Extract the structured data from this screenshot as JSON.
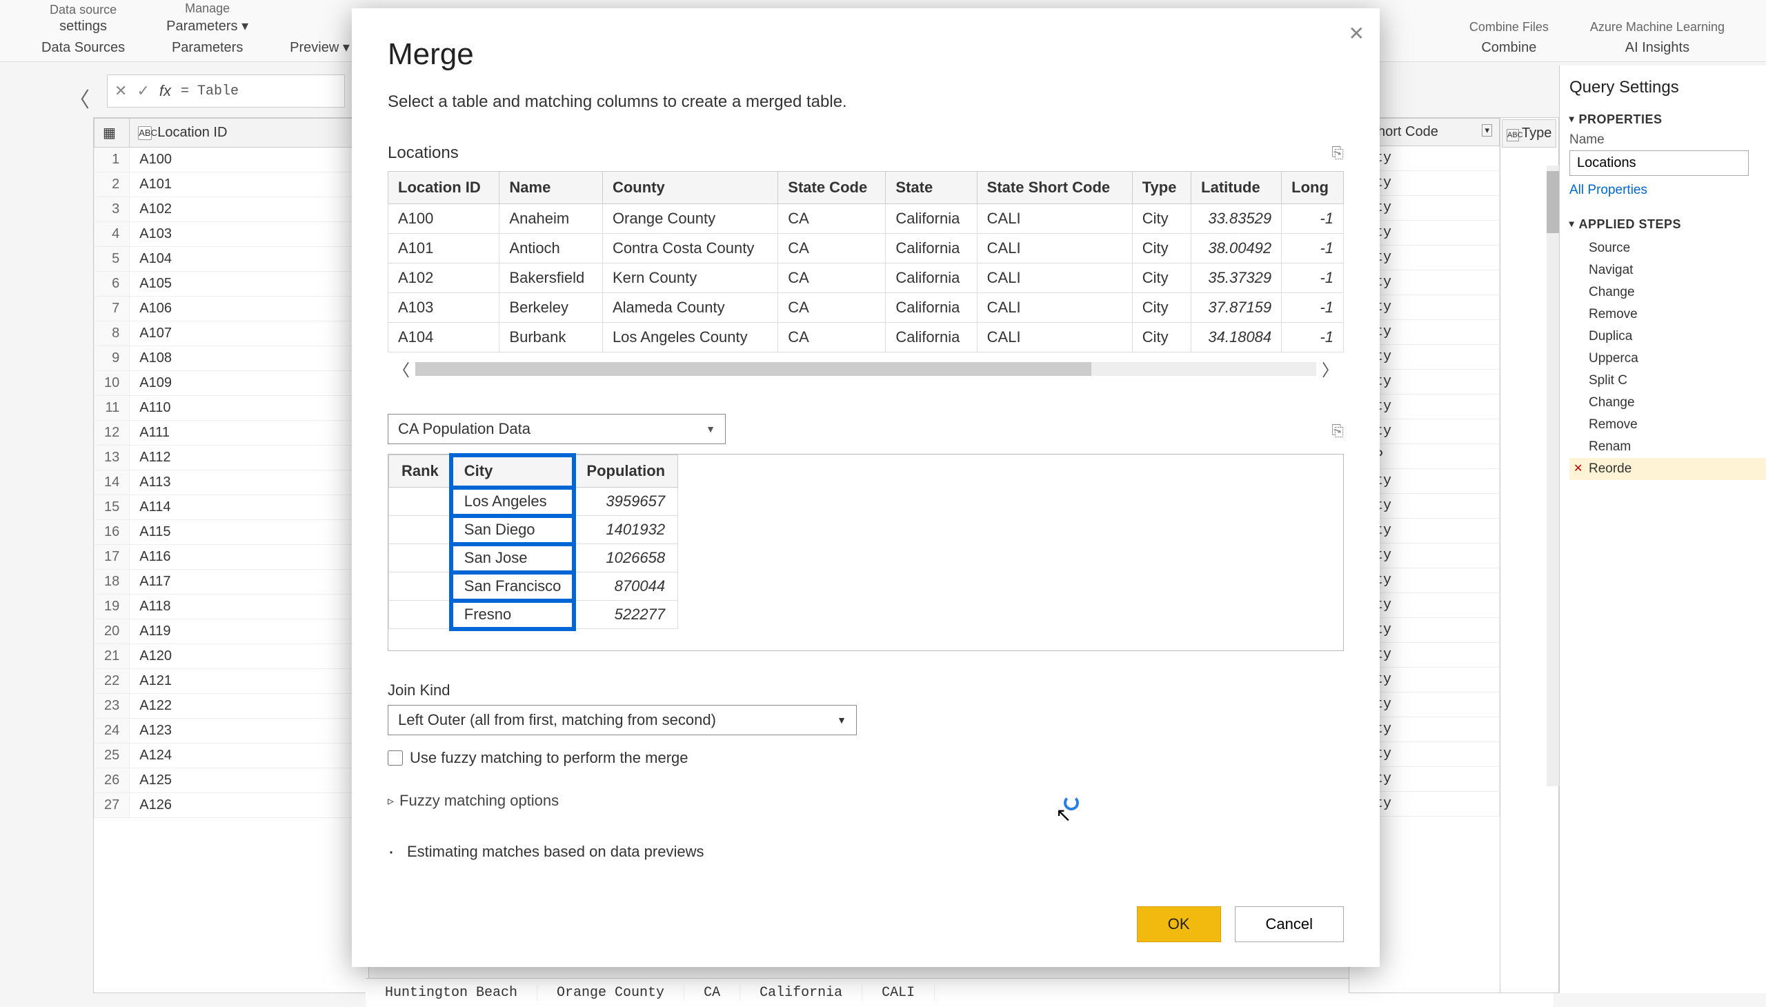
{
  "ribbon": {
    "left1_top": "Data source",
    "left1_bot": "settings",
    "left2_top": "Manage",
    "left2_bot": "Parameters ▾",
    "preview": "Preview ▾",
    "ds": "Data Sources",
    "params": "Parameters",
    "combine": "Combine Files",
    "combine_grp": "Combine",
    "aml": "Azure Machine Learning",
    "ai": "AI Insights"
  },
  "fx": {
    "cancel": "✕",
    "ok": "✓",
    "label": "fx",
    "formula": "= Table"
  },
  "left_table": {
    "col_icon": "ABC",
    "col": "Location ID",
    "rows": [
      "A100",
      "A101",
      "A102",
      "A103",
      "A104",
      "A105",
      "A106",
      "A107",
      "A108",
      "A109",
      "A110",
      "A111",
      "A112",
      "A113",
      "A114",
      "A115",
      "A116",
      "A117",
      "A118",
      "A119",
      "A120",
      "A121",
      "A122",
      "A123",
      "A124",
      "A125",
      "A126"
    ]
  },
  "type_col": {
    "header_short": "e Short Code",
    "header_type_icon": "ABC",
    "header_type": "Type",
    "cells": [
      "City",
      "City",
      "City",
      "City",
      "City",
      "City",
      "City",
      "City",
      "City",
      "City",
      "City",
      "City",
      "CDP",
      "City",
      "City",
      "City",
      "City",
      "City",
      "City",
      "City",
      "City",
      "City",
      "City",
      "City",
      "City",
      "City",
      "City"
    ]
  },
  "bg_row": {
    "name": "Huntington Beach",
    "county": "Orange County",
    "sc": "CA",
    "state": "California",
    "short": "CALI"
  },
  "qs": {
    "title": "Query Settings",
    "prop": "PROPERTIES",
    "name_lbl": "Name",
    "name_val": "Locations",
    "all_props": "All Properties",
    "steps_h": "APPLIED STEPS",
    "steps": [
      "Source",
      "Navigat",
      "Change",
      "Remove",
      "Duplica",
      "Upperca",
      "Split C",
      "Change",
      "Remove",
      "Renam",
      "Reorde"
    ]
  },
  "dlg": {
    "title": "Merge",
    "desc": "Select a table and matching columns to create a merged table.",
    "t1_label": "Locations",
    "t1_headers": [
      "Location ID",
      "Name",
      "County",
      "State Code",
      "State",
      "State Short Code",
      "Type",
      "Latitude",
      "Long"
    ],
    "t1_rows": [
      [
        "A100",
        "Anaheim",
        "Orange County",
        "CA",
        "California",
        "CALI",
        "City",
        "33.83529",
        "-1"
      ],
      [
        "A101",
        "Antioch",
        "Contra Costa County",
        "CA",
        "California",
        "CALI",
        "City",
        "38.00492",
        "-1"
      ],
      [
        "A102",
        "Bakersfield",
        "Kern County",
        "CA",
        "California",
        "CALI",
        "City",
        "35.37329",
        "-1"
      ],
      [
        "A103",
        "Berkeley",
        "Alameda County",
        "CA",
        "California",
        "CALI",
        "City",
        "37.87159",
        "-1"
      ],
      [
        "A104",
        "Burbank",
        "Los Angeles County",
        "CA",
        "California",
        "CALI",
        "City",
        "34.18084",
        "-1"
      ]
    ],
    "t2_dropdown": "CA Population Data",
    "t2_headers": [
      "Rank",
      "City",
      "Population"
    ],
    "t2_rows": [
      [
        "",
        "Los Angeles",
        "3959657"
      ],
      [
        "",
        "San Diego",
        "1401932"
      ],
      [
        "",
        "San Jose",
        "1026658"
      ],
      [
        "",
        "San Francisco",
        "870044"
      ],
      [
        "",
        "Fresno",
        "522277"
      ]
    ],
    "join_label": "Join Kind",
    "join_value": "Left Outer (all from first, matching from second)",
    "fuzzy_chk": "Use fuzzy matching to perform the merge",
    "fuzzy_opts": "Fuzzy matching options",
    "estimating": "Estimating matches based on data previews",
    "ok": "OK",
    "cancel": "Cancel"
  }
}
